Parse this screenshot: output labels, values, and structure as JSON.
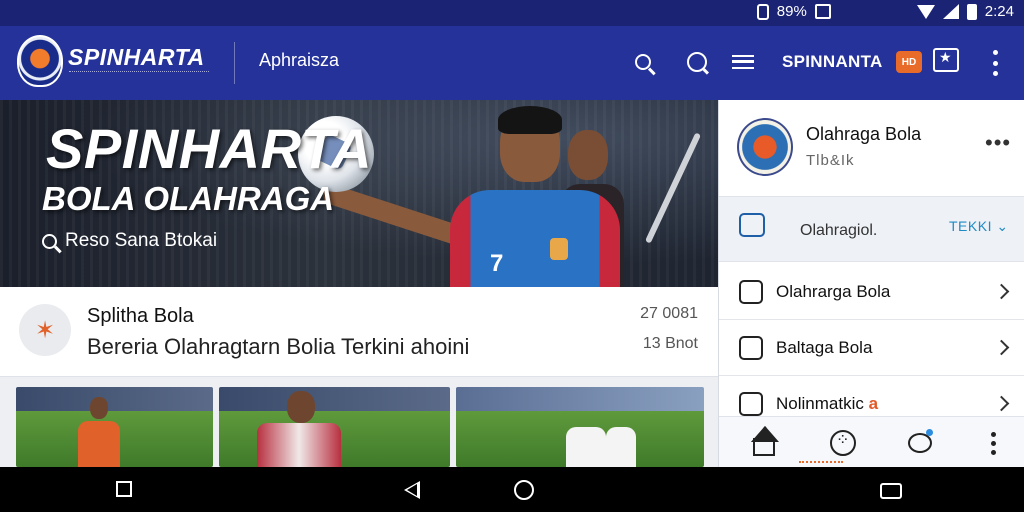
{
  "status_bar": {
    "battery_text": "89%",
    "time": "2:24",
    "icons": [
      "vibrate-icon",
      "image-icon",
      "signal-icon",
      "wifi-icon",
      "cellular-icon",
      "battery-icon"
    ]
  },
  "app_bar": {
    "brand": "SPINHARTA",
    "section": "Aphraisza",
    "brand_right": "SPINNANTA",
    "badge_text": "HD",
    "icons": [
      "search-icon",
      "chat-search-icon",
      "menu-icon",
      "share-icon",
      "more-vert-icon"
    ]
  },
  "hero": {
    "title": "SPINHARTA",
    "subtitle": "BOLA OLAHRAGA",
    "search_text": "Reso Sana Btokai"
  },
  "news": {
    "title": "Splitha Bola",
    "body": "Bereria Olahragtarn Bolia Terkini ahoini",
    "date": "27 0081",
    "time": "13 Bnot"
  },
  "side_panel": {
    "title": "Olahraga Bola",
    "subtitle": "Tlb&Ik",
    "more": "•••",
    "filter_label": "Olahragiol.",
    "filter_chip": "TEKKI",
    "items": [
      {
        "label": "Olahrarga Bola"
      },
      {
        "label": "Baltaga Bola"
      },
      {
        "label": "Nolinmatkic",
        "badge": "a"
      }
    ],
    "nav": [
      "home-icon",
      "apps-icon",
      "chat-icon",
      "more-vert-icon"
    ]
  },
  "colors": {
    "status_bar": "#1b2374",
    "app_bar": "#25329a",
    "accent_orange": "#e86b2a",
    "accent_blue": "#1f8bc6"
  }
}
